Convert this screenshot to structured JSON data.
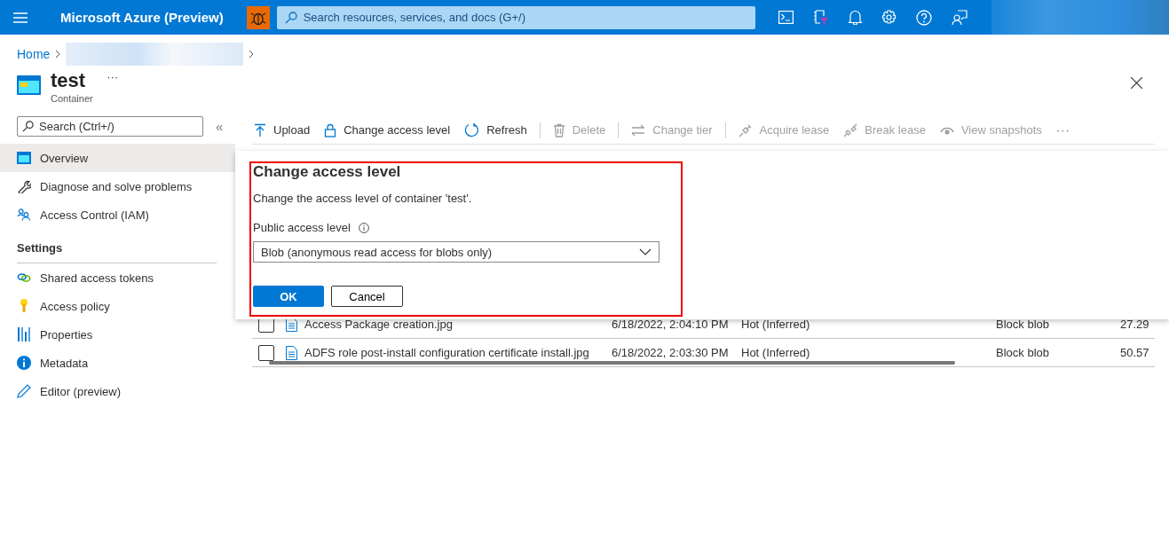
{
  "topbar": {
    "title": "Microsoft Azure (Preview)",
    "search": {
      "placeholder": "Search resources, services, and docs (G+/)"
    }
  },
  "breadcrumb": [
    {
      "label": "Home"
    }
  ],
  "resource": {
    "title": "test",
    "more": "···",
    "subtitle": "Container"
  },
  "sidebar": {
    "search": {
      "placeholder": "Search (Ctrl+/)"
    },
    "collapse": "«",
    "items": [
      {
        "label": "Overview",
        "selected": true
      },
      {
        "label": "Diagnose and solve problems",
        "selected": false
      },
      {
        "label": "Access Control (IAM)",
        "selected": false
      }
    ],
    "heading": "Settings",
    "settings_items": [
      {
        "label": "Shared access tokens",
        "selected": false
      },
      {
        "label": "Access policy",
        "selected": false
      },
      {
        "label": "Properties",
        "selected": false
      },
      {
        "label": "Metadata",
        "selected": false
      },
      {
        "label": "Editor (preview)",
        "selected": false
      }
    ]
  },
  "toolbar": [
    {
      "label": "Upload",
      "disabled": false
    },
    {
      "label": "Change access level",
      "disabled": false
    },
    {
      "label": "Refresh",
      "disabled": false
    },
    {
      "label": "Delete",
      "disabled": true
    },
    {
      "label": "Change tier",
      "disabled": true
    },
    {
      "label": "Acquire lease",
      "disabled": true
    },
    {
      "label": "Break lease",
      "disabled": true
    },
    {
      "label": "View snapshots",
      "disabled": true
    }
  ],
  "toolbar_more": "···",
  "table": {
    "rows": [
      {
        "checked": false,
        "name": "Access Package creation.jpg",
        "modified": "6/18/2022, 2:04:10 PM",
        "tier": "Hot (Inferred)",
        "type": "Block blob",
        "size": "27.29"
      },
      {
        "checked": false,
        "name": "ADFS role post-install configuration certificate install.jpg",
        "modified": "6/18/2022, 2:03:30 PM",
        "tier": "Hot (Inferred)",
        "type": "Block blob",
        "size": "50.57"
      }
    ]
  },
  "dialog": {
    "title": "Change access level",
    "description": "Change the access level of container 'test'.",
    "field_label": "Public access level",
    "select_value": "Blob (anonymous read access for blobs only)",
    "buttons": [
      {
        "label": "OK",
        "kind": "primary"
      },
      {
        "label": "Cancel",
        "kind": "secondary"
      }
    ]
  }
}
